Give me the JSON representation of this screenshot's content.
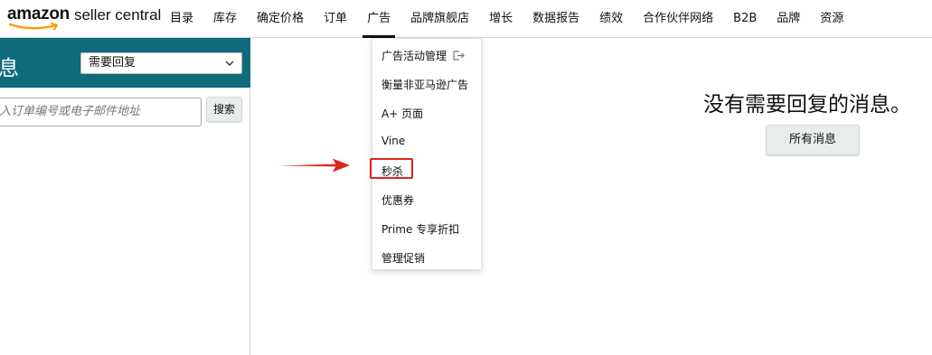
{
  "brand": {
    "amazon": "amazon",
    "product": "seller central"
  },
  "nav": {
    "items": [
      "目录",
      "库存",
      "确定价格",
      "订单",
      "广告",
      "品牌旗舰店",
      "增长",
      "数据报告",
      "绩效",
      "合作伙伴网络",
      "B2B",
      "品牌",
      "资源"
    ],
    "active_index": 4
  },
  "left": {
    "title": "息",
    "filter_value": "需要回复",
    "search_placeholder": "入订单编号或电子邮件地址",
    "search_button": "搜索"
  },
  "dropdown": {
    "items": [
      "广告活动管理",
      "衡量非亚马逊广告",
      "A+ 页面",
      "Vine",
      "秒杀",
      "优惠券",
      "Prime 专享折扣",
      "管理促销"
    ],
    "highlighted_index": 4,
    "external_icon": "external-link-icon"
  },
  "main": {
    "empty_message": "没有需要回复的消息。",
    "all_messages_button": "所有消息"
  },
  "colors": {
    "header_teal": "#0f6a7b",
    "annotation_red": "#e0241b",
    "logo_orange": "#ff9900"
  }
}
